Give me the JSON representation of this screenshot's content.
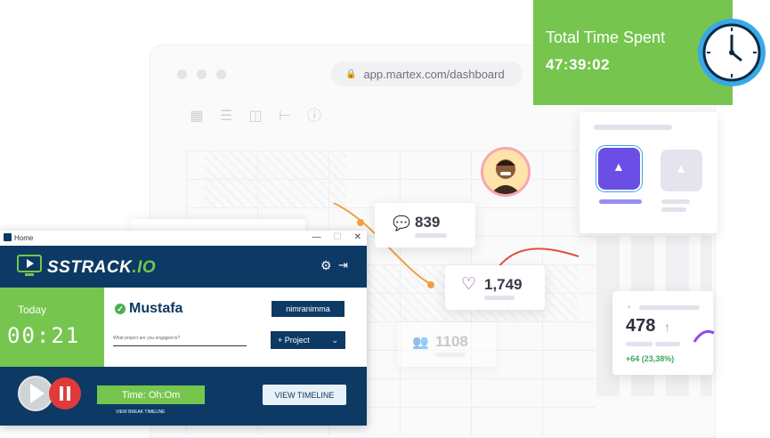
{
  "browser": {
    "url": "app.martex.com/dashboard"
  },
  "total_time": {
    "label": "Total Time Spent",
    "value": "47:39:02"
  },
  "stats": {
    "messages": "839",
    "likes": "1,749",
    "users": "1108",
    "metric": "478",
    "metric_change": "+64 (23,38%)"
  },
  "app": {
    "window_title": "Home",
    "brand_main": "SSTRACK",
    "brand_suffix": ".IO",
    "today_label": "Today",
    "timer": "00:21",
    "username": "Mustafa",
    "workspace": "nimranimma",
    "project_prompt": "What project are you engaged in?",
    "project_button": "+ Project",
    "time_label": "Time: Oh:Om",
    "break_timeline": "VIEW BREAK TIMELINE",
    "view_timeline": "VIEW TIMELINE"
  },
  "colors": {
    "green": "#76c54f",
    "navy": "#0c3a64",
    "purple": "#6b4ee6",
    "red": "#e03a3a"
  }
}
